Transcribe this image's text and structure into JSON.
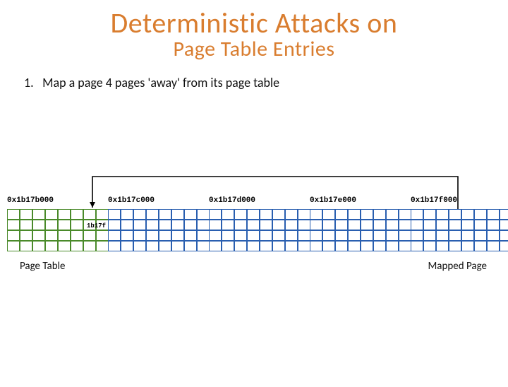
{
  "title": {
    "main": "Deterministic Attacks on",
    "sub": "Page Table Entries"
  },
  "step": {
    "number": "1.",
    "text": "Map a page 4 pages 'away' from its page table"
  },
  "addresses": [
    "0x1b17b000",
    "0x1b17c000",
    "0x1b17d000",
    "0x1b17e000",
    "0x1b17f000"
  ],
  "page_table_entry_label": "1b17f",
  "captions": {
    "left": "Page Table",
    "right": "Mapped Page"
  },
  "grid": {
    "blocks": 5,
    "cols_per_block": 8,
    "rows": 4,
    "green_block_index": 0
  }
}
